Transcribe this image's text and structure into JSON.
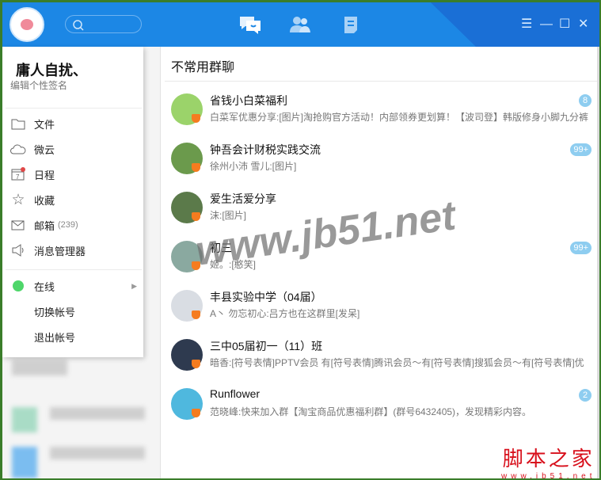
{
  "header": {
    "nav": [
      "messages",
      "contacts",
      "space"
    ]
  },
  "profile": {
    "name": "庸人自扰、",
    "signature": "编辑个性签名"
  },
  "menu": {
    "items": [
      {
        "label": "文件",
        "icon": "folder-icon"
      },
      {
        "label": "微云",
        "icon": "cloud-icon"
      },
      {
        "label": "日程",
        "icon": "calendar-icon"
      },
      {
        "label": "收藏",
        "icon": "star-icon"
      },
      {
        "label": "邮箱",
        "count": "(239)",
        "icon": "mail-icon"
      },
      {
        "label": "消息管理器",
        "icon": "speaker-icon"
      }
    ],
    "status": "在线",
    "switch": "切换帐号",
    "logout": "退出帐号",
    "calendar_day": "7"
  },
  "main": {
    "title": "不常用群聊",
    "groups": [
      {
        "name": "省钱小白菜福利",
        "msg": "白菜军优惠分享:[图片]淘抢购官方活动！内部领券更划算！【波司登】韩版修身小脚九分裤",
        "count": "8",
        "color": "#9bd36a"
      },
      {
        "name": "钟吾会计财税实践交流",
        "msg": "徐州小沛   雪儿:[图片]",
        "count": "99+",
        "color": "#6b9a4c"
      },
      {
        "name": "爱生活爱分享",
        "msg": "沫:[图片]",
        "count": null,
        "color": "#5b7a4a"
      },
      {
        "name": "初三",
        "msg": "  姬。:[憨笑]",
        "count": "99+",
        "color": "#8aa9a0"
      },
      {
        "name": "丰县实验中学（04届）",
        "msg": "A丶 勿忘初心:吕方也在这群里[发呆]",
        "count": null,
        "color": "#d9dde3"
      },
      {
        "name": "三中05届初一（11）班",
        "msg": "暗香:[符号表情]PPTV会员 有[符号表情]腾讯会员～有[符号表情]搜狐会员～有[符号表情]优",
        "count": null,
        "color": "#2e3a4f"
      },
      {
        "name": "Runflower",
        "msg": "范晓峰:快来加入群【淘宝商品优惠福利群】(群号6432405)，发现精彩内容。",
        "count": "2",
        "color": "#4fb8de"
      }
    ]
  },
  "watermark": "www.jb51.net",
  "logo": {
    "text": "脚本之家",
    "url": "www.jb51.net"
  }
}
